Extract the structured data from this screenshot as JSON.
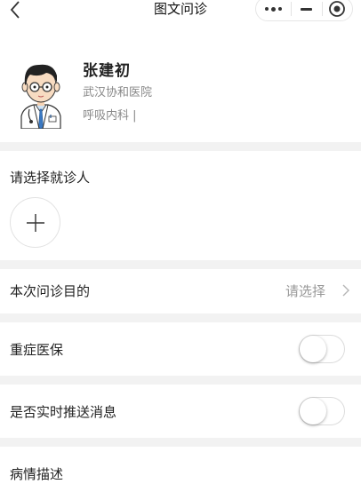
{
  "navbar": {
    "title": "图文问诊",
    "icons": {
      "back": "chevron-left-icon",
      "more": "more-dots-icon",
      "minimize": "minimize-icon",
      "close": "target-close-icon"
    }
  },
  "doctor": {
    "name": "张建初",
    "hospital": "武汉协和医院",
    "department": "呼吸内科 |",
    "avatar_icon": "doctor-avatar"
  },
  "patient": {
    "title": "请选择就诊人",
    "add_icon": "plus-icon"
  },
  "purpose": {
    "label": "本次问诊目的",
    "value": "请选择"
  },
  "insurance": {
    "label": "重症医保",
    "enabled": false
  },
  "push": {
    "label": "是否实时推送消息",
    "enabled": false
  },
  "description": {
    "label": "病情描述"
  },
  "colors": {
    "section_gap": "#f2f2f2",
    "muted_text": "#888888",
    "placeholder_text": "#999999"
  }
}
